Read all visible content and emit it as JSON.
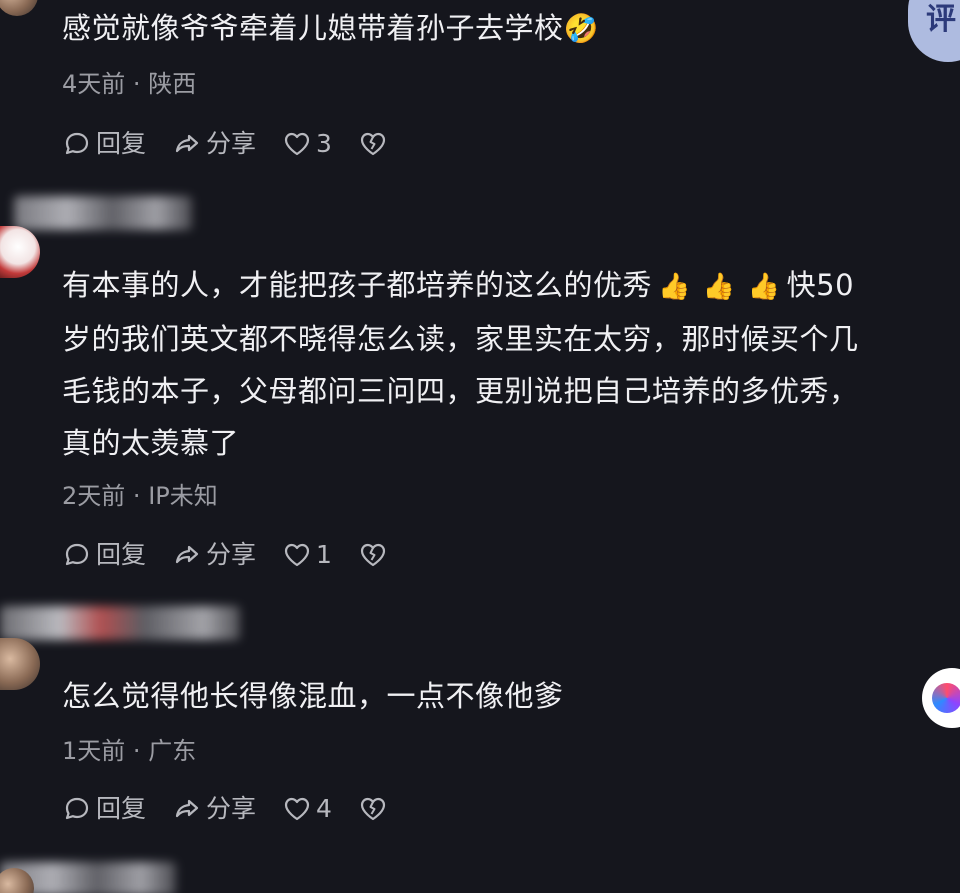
{
  "floating_button_top": {
    "label": "评"
  },
  "comments": [
    {
      "text": "感觉就像爷爷牵着儿媳带着孙子去学校",
      "emoji": "🤣",
      "time": "4天前",
      "location": "陕西",
      "reply_label": "回复",
      "share_label": "分享",
      "likes": "3"
    },
    {
      "lines": [
        "有本事的人，才能把孩子都培养的这么的优秀",
        "快50",
        "岁的我们英文都不晓得怎么读，家里实在太穷，那时候买个几",
        "毛钱的本子，父母都问三问四，更别说把自己培养的多优秀，",
        "真的太羡慕了"
      ],
      "thumbs": [
        "👍",
        "👍",
        "👍"
      ],
      "time": "2天前",
      "location": "IP未知",
      "reply_label": "回复",
      "share_label": "分享",
      "likes": "1"
    },
    {
      "text": "怎么觉得他长得像混血，一点不像他爹",
      "time": "1天前",
      "location": "广东",
      "reply_label": "回复",
      "share_label": "分享",
      "likes": "4"
    }
  ],
  "meta_separator": "·",
  "icons": {
    "reply": "comment-bubble-icon",
    "share": "share-arrow-icon",
    "like": "heart-icon",
    "dislike": "broken-heart-icon"
  },
  "colors": {
    "background": "#15161d",
    "text": "#f0f0f3",
    "meta": "#9b9ca3",
    "action": "#b7b8be"
  }
}
